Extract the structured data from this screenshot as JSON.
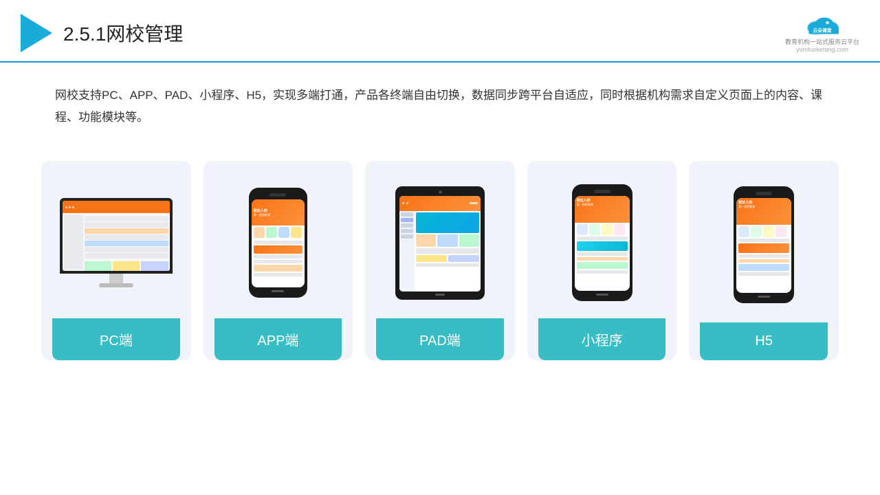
{
  "header": {
    "page_number": "2.5.1",
    "page_title": "网校管理",
    "brand_name": "云朵课堂",
    "brand_url": "yunduoketang.com",
    "brand_tagline": "教育机构一站式服务云平台"
  },
  "description": {
    "text": "网校支持PC、APP、PAD、小程序、H5，实现多端打通，产品各终端自由切换，数据同步跨平台自适应，同时根据机构需求自定义页面上的内容、课程、功能模块等。"
  },
  "cards": [
    {
      "id": "pc",
      "label": "PC端"
    },
    {
      "id": "app",
      "label": "APP端"
    },
    {
      "id": "pad",
      "label": "PAD端"
    },
    {
      "id": "miniprogram",
      "label": "小程序"
    },
    {
      "id": "h5",
      "label": "H5"
    }
  ],
  "colors": {
    "accent": "#38bdc4",
    "header_border": "#1296db",
    "triangle": "#1aabdb",
    "card_bg": "#f0f4fa",
    "label_bg": "#38bdc4"
  }
}
